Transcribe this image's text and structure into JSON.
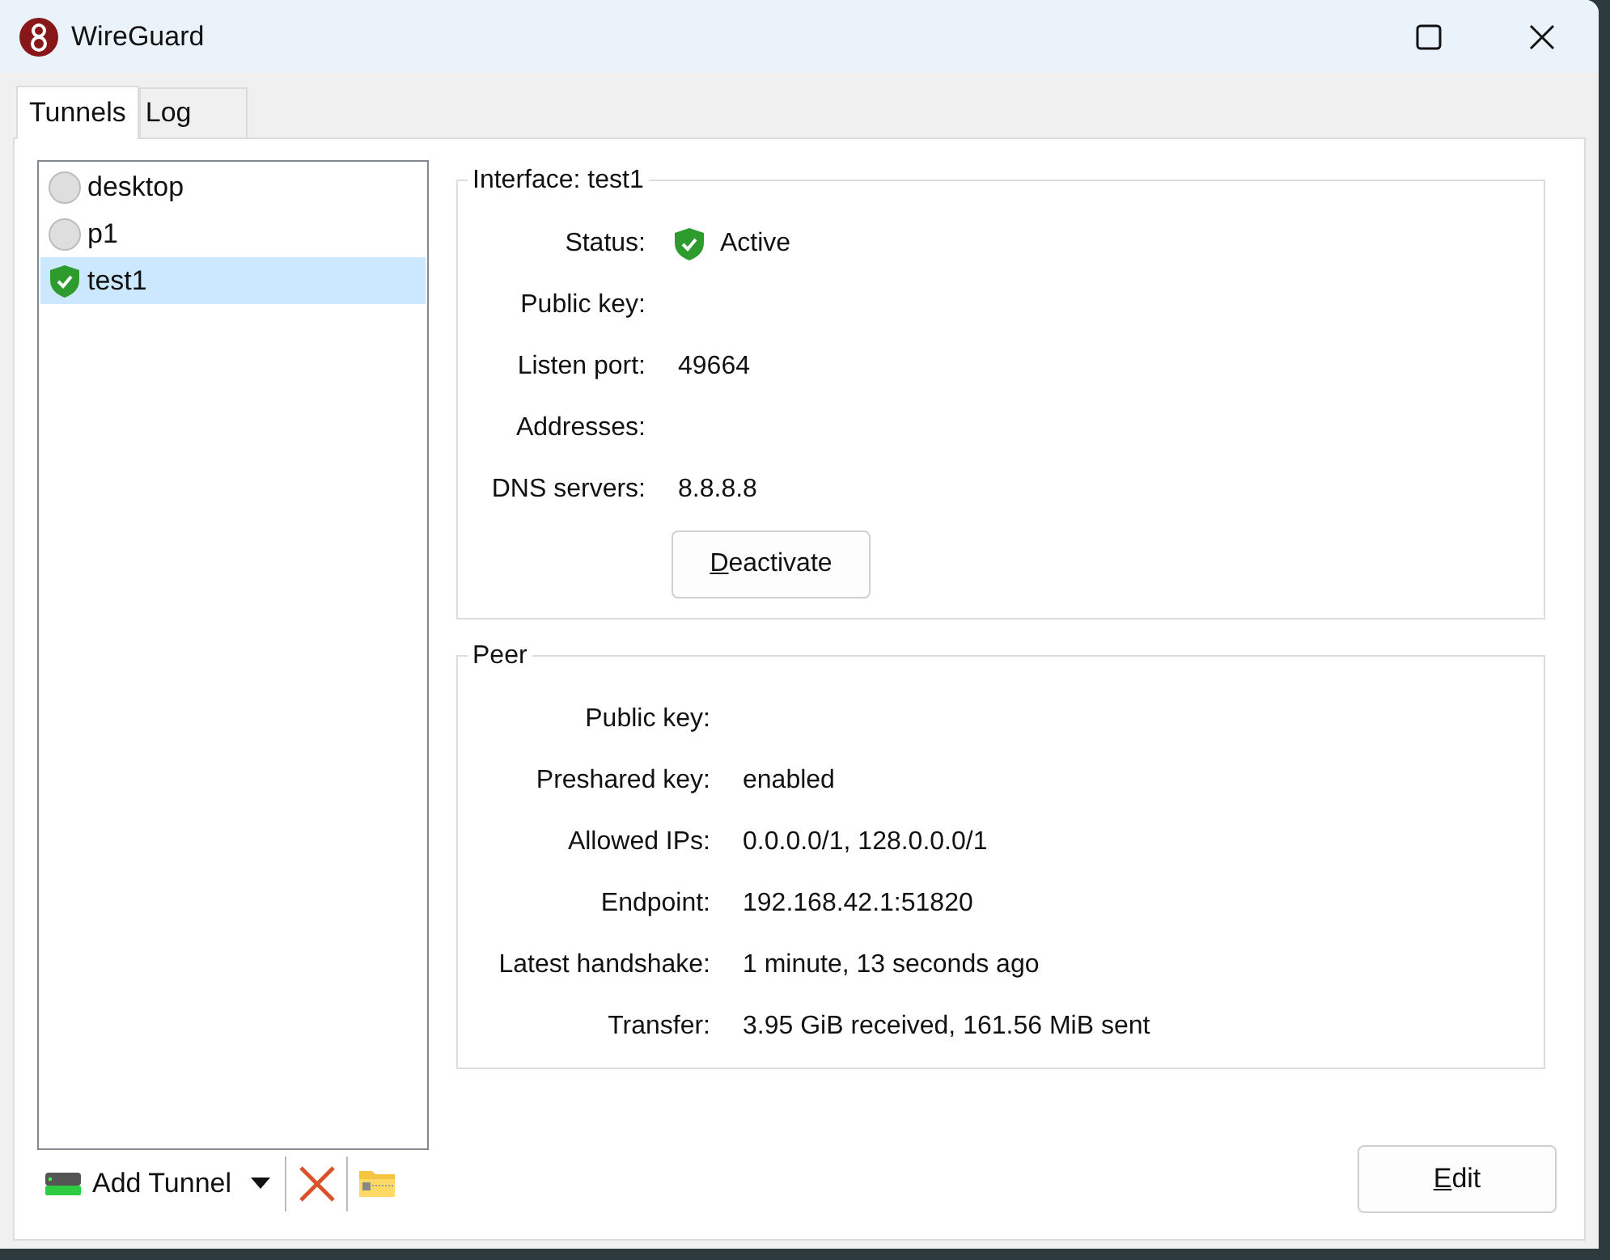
{
  "window": {
    "title": "WireGuard"
  },
  "tabs": [
    {
      "label": "Tunnels",
      "selected": true
    },
    {
      "label": "Log",
      "selected": false
    }
  ],
  "tunnels": [
    {
      "name": "desktop",
      "active": false,
      "selected": false
    },
    {
      "name": "p1",
      "active": false,
      "selected": false
    },
    {
      "name": "test1",
      "active": true,
      "selected": true
    }
  ],
  "toolbar": {
    "add_label": "Add Tunnel"
  },
  "interface": {
    "title": "Interface: test1",
    "fields": [
      {
        "label": "Status:",
        "value": "Active",
        "kind": "status",
        "active": true
      },
      {
        "label": "Public key:",
        "kind": "text"
      },
      {
        "label": "Listen port:",
        "value": "49664",
        "kind": "text"
      },
      {
        "label": "Addresses:",
        "kind": "text"
      },
      {
        "label": "DNS servers:",
        "value": "8.8.8.8",
        "kind": "text"
      }
    ],
    "button": "Deactivate"
  },
  "peer": {
    "title": "Peer",
    "fields": [
      {
        "label": "Public key:"
      },
      {
        "label": "Preshared key:",
        "value": "enabled"
      },
      {
        "label": "Allowed IPs:",
        "value": "0.0.0.0/1, 128.0.0.0/1"
      },
      {
        "label": "Endpoint:",
        "value": "192.168.42.1:51820"
      },
      {
        "label": "Latest handshake:",
        "value": "1 minute, 13 seconds ago"
      },
      {
        "label": "Transfer:",
        "value": "3.95 GiB received, 161.56 MiB sent"
      }
    ]
  },
  "edit_button": "Edit"
}
